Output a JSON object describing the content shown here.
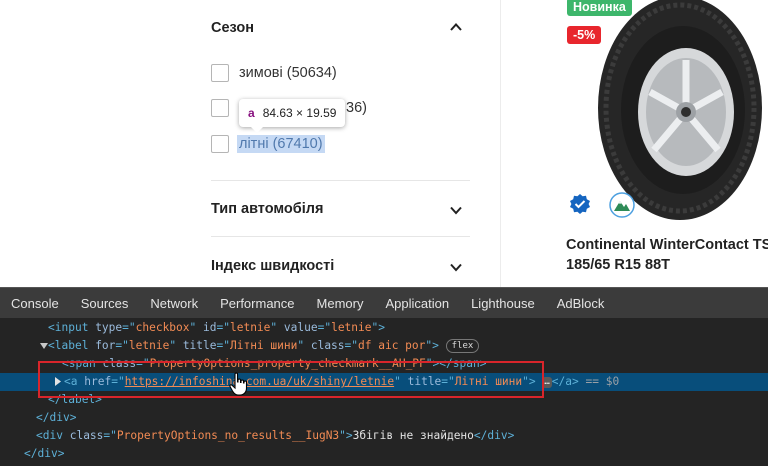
{
  "filters": {
    "season": {
      "title": "Сезон",
      "options": [
        {
          "label": "зимові (50634)",
          "checked": false
        },
        {
          "label": "всесезонні (3836)",
          "visible_label": "36)",
          "checked": false
        },
        {
          "label": "літні (67410)",
          "checked": false,
          "highlighted": true
        }
      ]
    },
    "car_type_title": "Тип автомобіля",
    "speed_index_title": "Індекс швидкості"
  },
  "inspector_tooltip": {
    "tag": "a",
    "size": "84.63 × 19.59"
  },
  "product": {
    "badges": {
      "new": "Новинка",
      "discount": "-5%"
    },
    "name_line1": "Continental WinterContact TS",
    "name_line2": "185/65 R15 88T",
    "brand": "Continental",
    "model": "WinterContact"
  },
  "devtools": {
    "tabs": [
      "Console",
      "Sources",
      "Network",
      "Performance",
      "Memory",
      "Application",
      "Lighthouse",
      "AdBlock"
    ],
    "lines": {
      "l1": {
        "tag": "input",
        "a1n": "type",
        "a1v": "checkbox",
        "a2n": "id",
        "a2v": "letnie",
        "a3n": "value",
        "a3v": "letnie"
      },
      "l2": {
        "tag": "label",
        "a1n": "for",
        "a1v": "letnie",
        "a2n": "title",
        "a2v": "Літні шини",
        "a3n": "class",
        "a3v": "df aic por",
        "badge": "flex"
      },
      "l3": {
        "tag": "span",
        "a1n": "class",
        "a1v": "PropertyOptions_property_checkmark__AH_PF"
      },
      "l4": {
        "tag": "a",
        "hrefn": "href",
        "href": "https://infoshina.com.ua/uk/shiny/letnie",
        "a2n": "title",
        "a2v": "Літні шини",
        "ellipsis": "…",
        "suffix": "== $0"
      },
      "l5": {
        "close": "label"
      },
      "l6": {
        "close": "div"
      },
      "l7": {
        "tag": "div",
        "a1n": "class",
        "a1v": "PropertyOptions_no_results__IugN3",
        "text": "Збігів не знайдено"
      },
      "l8": {
        "close": "div"
      },
      "l9": {
        "close": "div"
      }
    }
  },
  "colors": {
    "devtools_bg": "#242424",
    "selected_row": "#084e7b",
    "red_box": "#d9252b",
    "new_badge": "#3db66b",
    "sale_badge": "#e8262d"
  }
}
